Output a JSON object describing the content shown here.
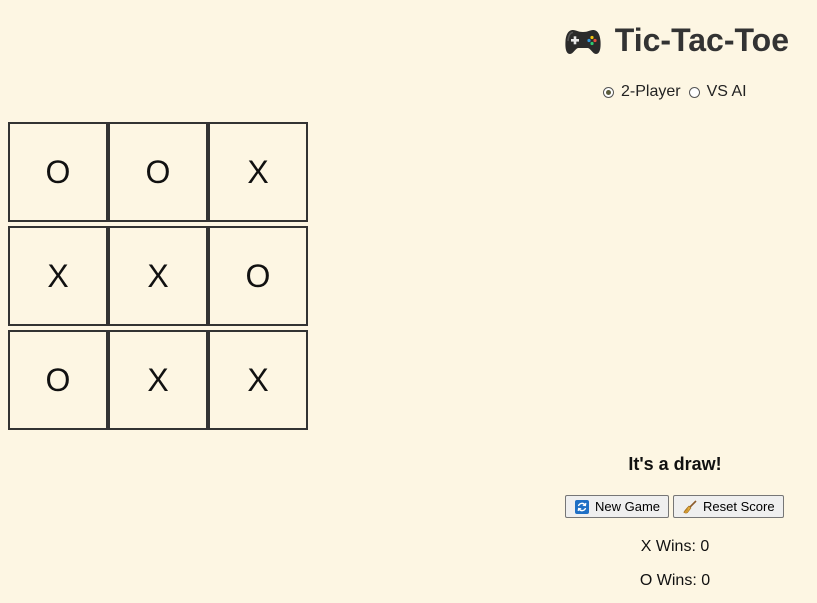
{
  "title": "Tic-Tac-Toe",
  "title_icon": "gamepad-icon",
  "mode": {
    "options": [
      {
        "label": "2-Player",
        "checked": true
      },
      {
        "label": "VS AI",
        "checked": false
      }
    ]
  },
  "board": {
    "cells": [
      "O",
      "O",
      "X",
      "X",
      "X",
      "O",
      "O",
      "X",
      "X"
    ]
  },
  "status": "It's a draw!",
  "buttons": {
    "new_game": {
      "label": "New Game",
      "icon": "refresh-icon"
    },
    "reset_score": {
      "label": "Reset Score",
      "icon": "broom-icon"
    }
  },
  "score": {
    "x": "X Wins: 0",
    "o": "O Wins: 0"
  }
}
